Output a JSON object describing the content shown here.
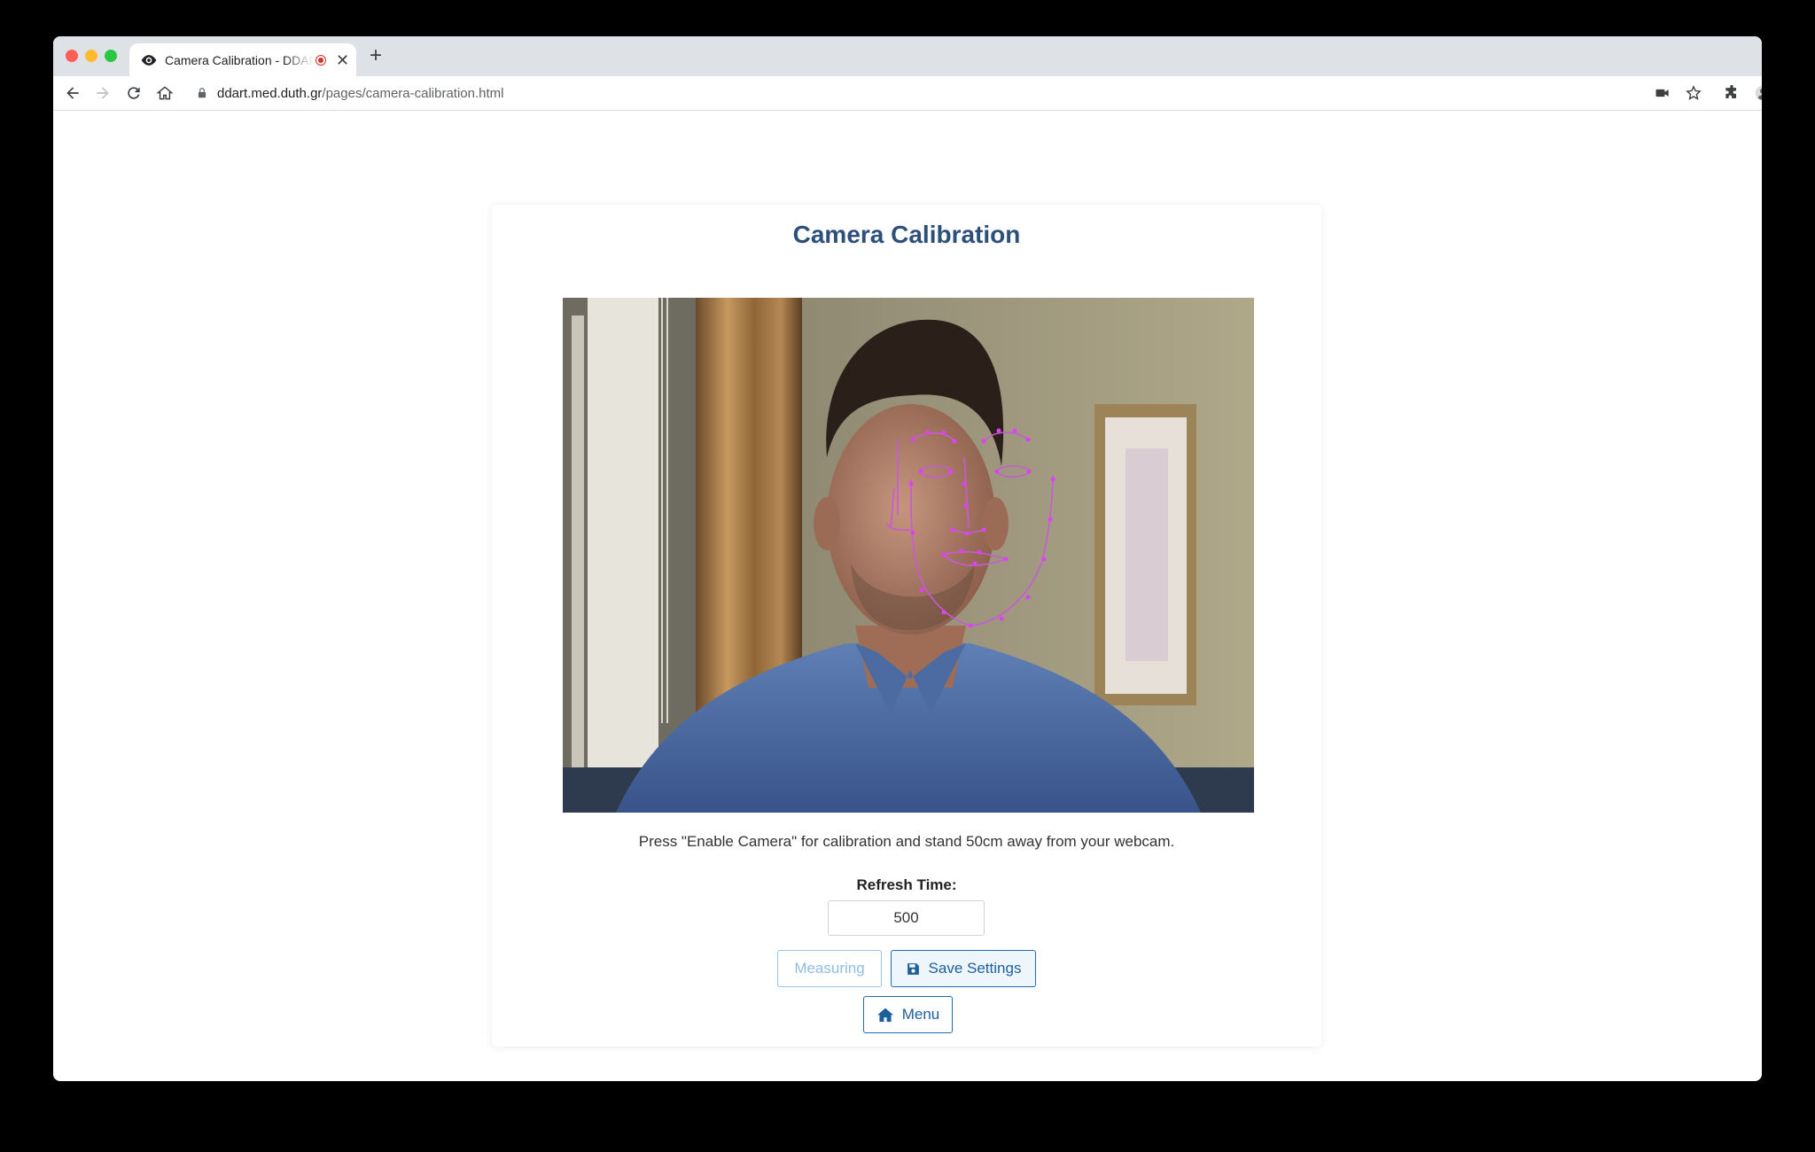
{
  "browser": {
    "tab_title": "Camera Calibration - DDART",
    "url_domain": "ddart.med.duth.gr",
    "url_path": "/pages/camera-calibration.html"
  },
  "page": {
    "title": "Camera Calibration",
    "instruction": "Press \"Enable Camera\" for calibration and stand 50cm away from your webcam.",
    "refresh_label": "Refresh Time:",
    "refresh_value": "500",
    "buttons": {
      "measuring": "Measuring",
      "save": "Save Settings",
      "menu": "Menu"
    }
  },
  "colors": {
    "title": "#2c4f7c",
    "button_border": "#1c6db2",
    "landmark": "#e040fb"
  }
}
